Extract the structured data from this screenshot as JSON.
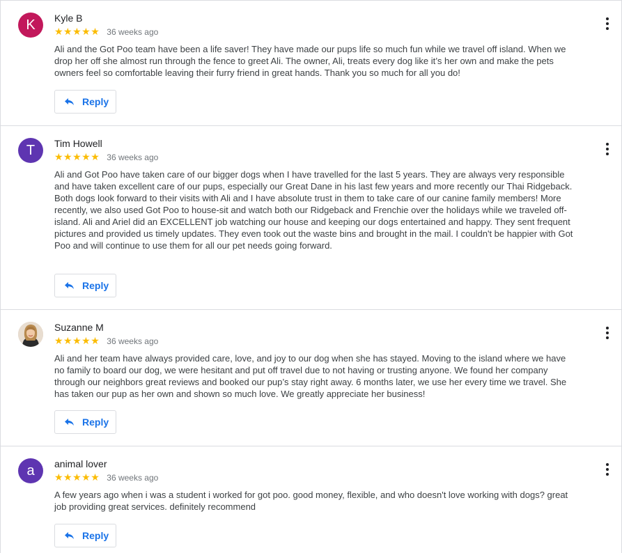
{
  "reviews": [
    {
      "name": "Kyle B",
      "avatar": {
        "type": "letter",
        "letter": "K",
        "color": "#c2185b"
      },
      "stars": "★★★★★",
      "rating": 5,
      "time": "36 weeks ago",
      "text": "Ali and the Got Poo team have been a life saver! They have made our pups life so much fun while we travel off island. When we drop her off she almost run through the fence to greet Ali. The owner, Ali, treats every dog like it’s her own and make the pets owners feel so comfortable leaving their furry friend in great hands. Thank you so much for all you do!",
      "reply_label": "Reply",
      "menu_icon": "more-vertical-icon"
    },
    {
      "name": "Tim Howell",
      "avatar": {
        "type": "letter",
        "letter": "T",
        "color": "#5e35b1"
      },
      "stars": "★★★★★",
      "rating": 5,
      "time": "36 weeks ago",
      "text": "Ali and Got Poo have taken care of our bigger dogs when I have travelled for the last 5 years. They are always very responsible and have taken excellent care of our pups, especially our Great Dane in his last few years and more recently our Thai Ridgeback. Both dogs look forward to their visits with Ali and I have absolute trust in them to take care of our canine family members! More recently, we also used Got Poo to house-sit and watch both our Ridgeback and Frenchie over the holidays while we traveled off-island. Ali and Ariel did an EXCELLENT job watching our house and keeping our dogs entertained and happy. They sent frequent pictures and provided us timely updates. They even took out the waste bins and brought in the mail. I couldn't be happier with Got Poo and will continue to use them for all our pet needs going forward.",
      "reply_label": "Reply",
      "menu_icon": "more-vertical-icon"
    },
    {
      "name": "Suzanne M",
      "avatar": {
        "type": "photo",
        "letter": "",
        "color": "#d7c7b2"
      },
      "stars": "★★★★★",
      "rating": 5,
      "time": "36 weeks ago",
      "text": "Ali and her team have always provided care, love, and joy to our dog when she has stayed. Moving to the island where we have no family to board our dog, we were hesitant and put off travel due to not having or trusting anyone. We found her company through our neighbors great reviews and booked our pup’s stay right away. 6 months later, we use her every time we travel. She has taken our pup as her own and shown so much love. We greatly appreciate her business!",
      "reply_label": "Reply",
      "menu_icon": "more-vertical-icon"
    },
    {
      "name": "animal lover",
      "avatar": {
        "type": "letter",
        "letter": "a",
        "color": "#5e35b1"
      },
      "stars": "★★★★★",
      "rating": 5,
      "time": "36 weeks ago",
      "text": "A few years ago when i was a student i worked for got poo. good money, flexible, and who doesn't love working with dogs? great job providing great services. definitely recommend",
      "reply_label": "Reply",
      "menu_icon": "more-vertical-icon"
    }
  ],
  "colors": {
    "star": "#fbbc04",
    "link": "#1a73e8",
    "divider": "#dadce0"
  }
}
